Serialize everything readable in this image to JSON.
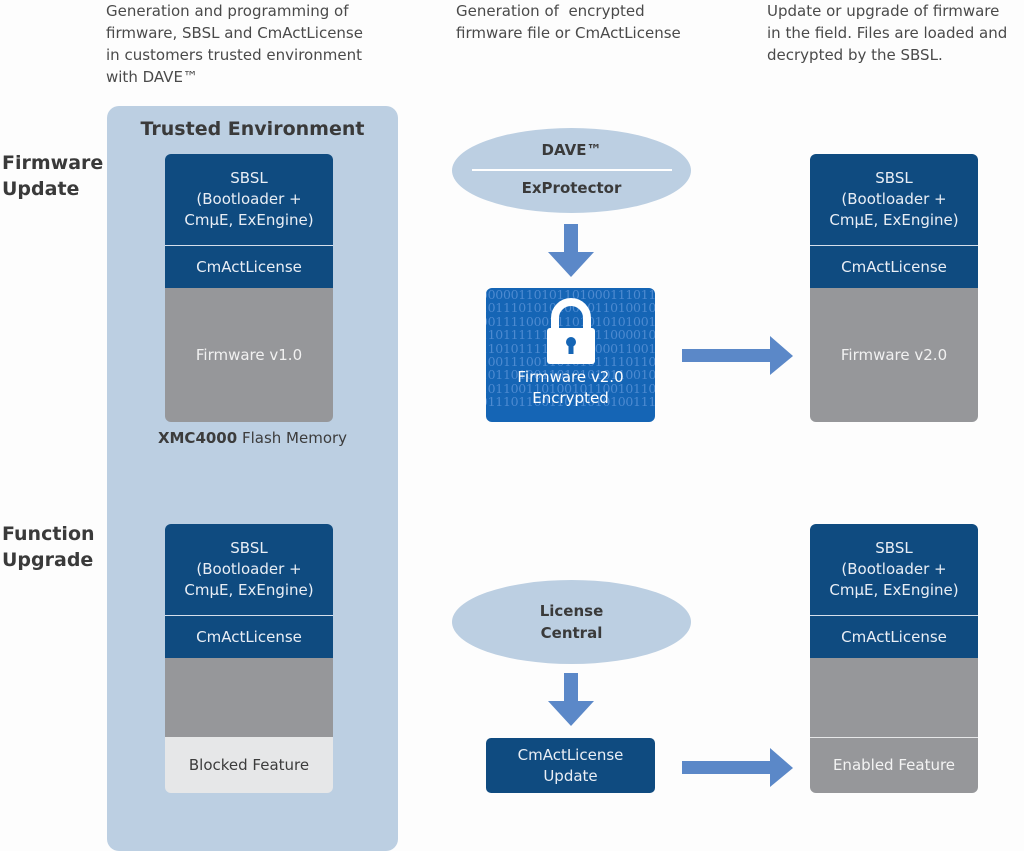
{
  "captions": {
    "left": "Generation and programming of firmware, SBSL and CmActLicense in customers trusted environment with DAVE™",
    "left_lines": [
      "Generation and programming of",
      "firmware, SBSL and CmActLicense",
      "in customers trusted environment",
      "with DAVE™"
    ],
    "middle_lines": [
      "Generation of  encrypted",
      "firmware file or CmActLicense"
    ],
    "right_lines": [
      "Update or upgrade of firmware",
      "in the field. Files are loaded and",
      "decrypted by the SBSL."
    ]
  },
  "row_labels": {
    "firmware_update": [
      "Firmware",
      "Update"
    ],
    "function_upgrade": [
      "Function",
      "Upgrade"
    ]
  },
  "trusted_environment": {
    "title": "Trusted Environment",
    "flash_memory_bold": "XMC4000",
    "flash_memory_rest": " Flash Memory"
  },
  "memory_blocks": {
    "sbsl_lines": [
      "SBSL",
      "(Bootloader +",
      "CmµE, ExEngine)"
    ],
    "license": "CmActLicense",
    "fw_update_before": "Firmware v1.0",
    "fw_update_after": "Firmware v2.0",
    "upgrade_before_feature": "Blocked Feature",
    "upgrade_after_feature": "Enabled Feature"
  },
  "tools": {
    "dave_top": "DAVE™",
    "dave_bottom": "ExProtector",
    "license_central_lines": [
      "License",
      "Central"
    ]
  },
  "encrypted_file": {
    "lines": [
      "Firmware v2.0",
      "Encrypted"
    ],
    "binary_rows": [
      "0000011010110100011101101",
      "1011101010100001101001011",
      "0011110001110101010100101",
      "1101111110100111100001011",
      "1101011110101010001100101",
      "1001110011010101111011011",
      "1011010011010101011001011",
      "1011001101001011001011011",
      "0111011001101101010011101"
    ]
  },
  "license_update_lines": [
    "CmActLicense",
    "Update"
  ],
  "colors": {
    "dark_blue": "#0f4b80",
    "light_blue": "#bccfe2",
    "arrow_blue": "#5b88c8",
    "gray": "#96979a",
    "light_gray": "#e6e7e8",
    "encrypted_blue": "#1565b5"
  }
}
